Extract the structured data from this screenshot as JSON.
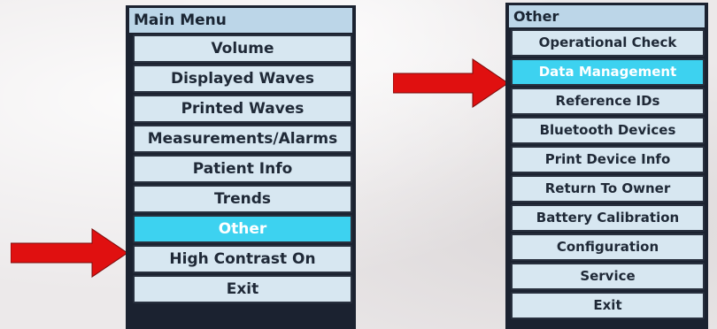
{
  "left_screen": {
    "title": "Main Menu",
    "items": [
      {
        "label": "Volume"
      },
      {
        "label": "Displayed Waves"
      },
      {
        "label": "Printed Waves"
      },
      {
        "label": "Measurements/Alarms"
      },
      {
        "label": "Patient Info"
      },
      {
        "label": "Trends"
      },
      {
        "label": "Other",
        "selected": true
      },
      {
        "label": "High Contrast On"
      },
      {
        "label": "Exit"
      }
    ]
  },
  "right_screen": {
    "title": "Other",
    "items": [
      {
        "label": "Operational Check"
      },
      {
        "label": "Data Management",
        "selected": true
      },
      {
        "label": "Reference IDs"
      },
      {
        "label": "Bluetooth Devices"
      },
      {
        "label": "Print Device Info"
      },
      {
        "label": "Return To Owner"
      },
      {
        "label": "Battery Calibration"
      },
      {
        "label": "Configuration"
      },
      {
        "label": "Service"
      },
      {
        "label": "Exit"
      }
    ]
  },
  "colors": {
    "screen_background": "#1b2230",
    "item_background": "#d7e7f1",
    "selected_background": "#3dd2f0",
    "arrow": "#e01010"
  },
  "icons": {
    "pointer_arrows": "right-arrow-icon"
  }
}
